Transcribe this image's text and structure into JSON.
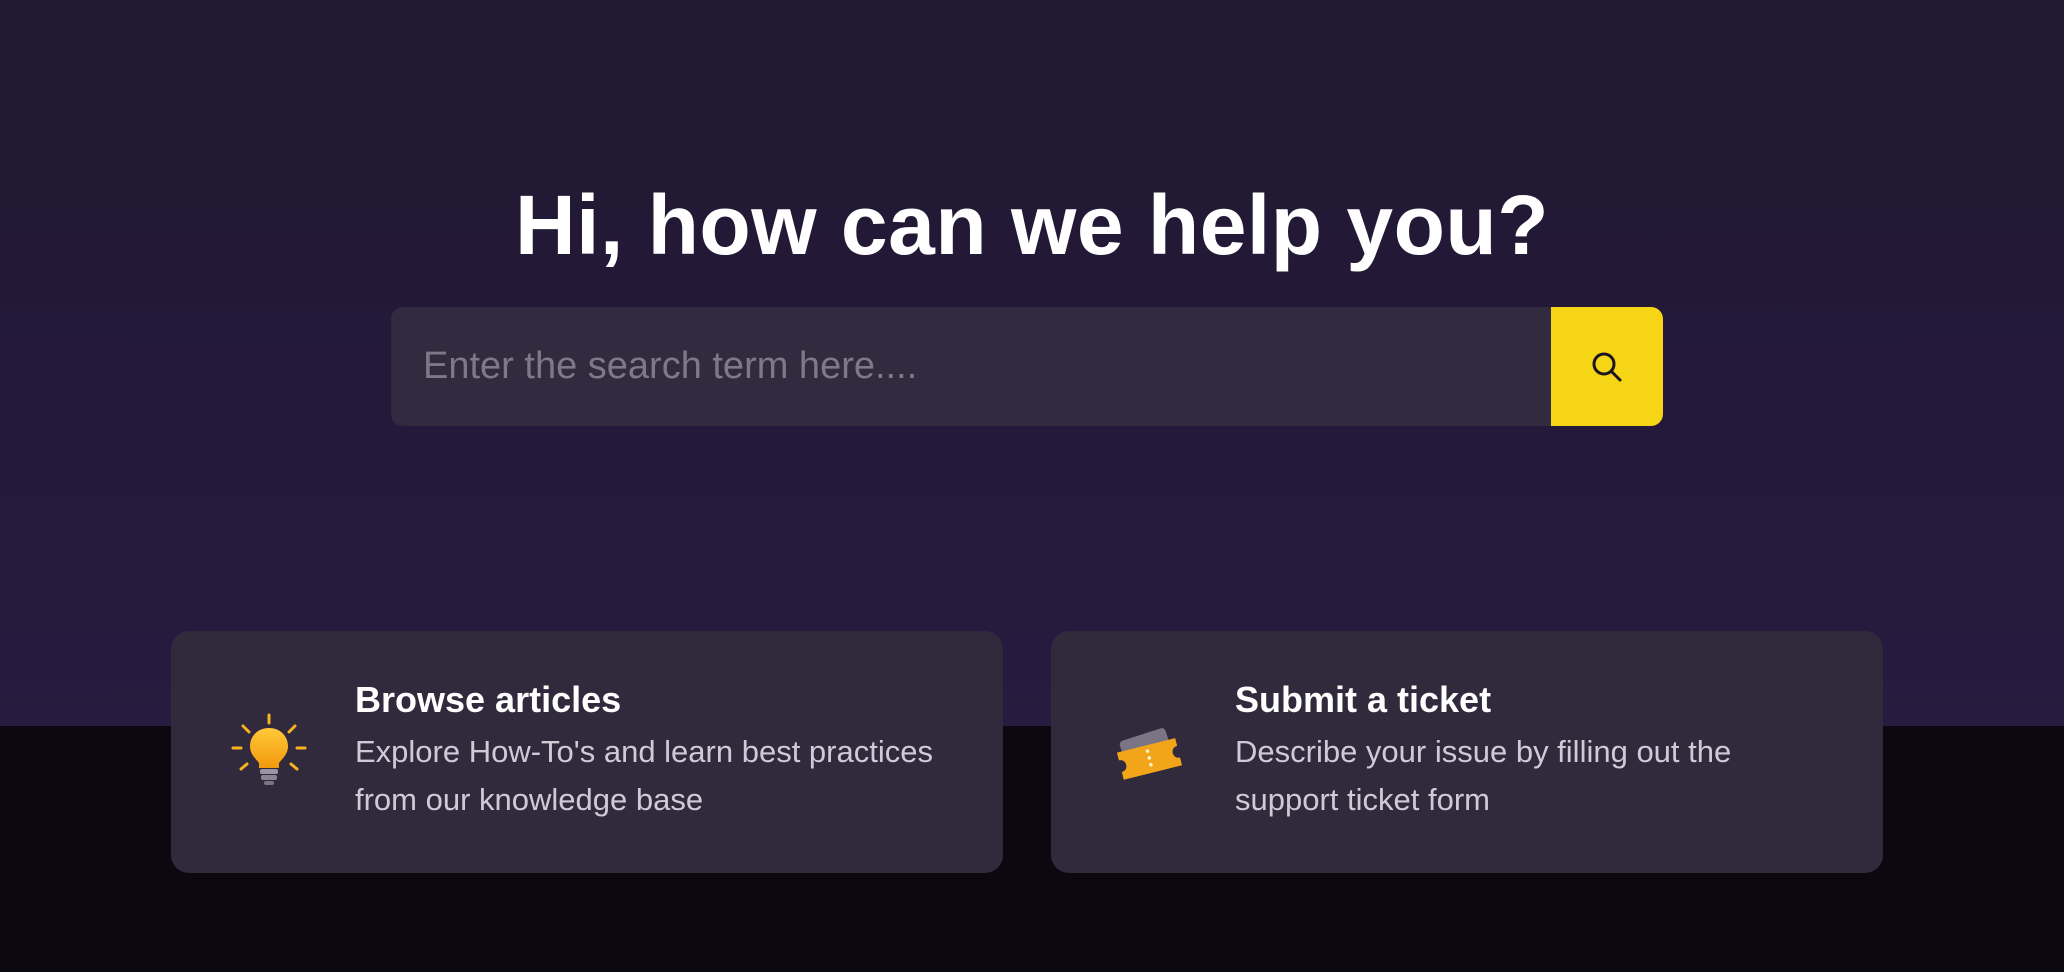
{
  "hero": {
    "title": "Hi, how can we help you?"
  },
  "search": {
    "placeholder": "Enter the search term here....",
    "value": "",
    "button_icon": "search-icon"
  },
  "cards": [
    {
      "icon": "lightbulb-icon",
      "title": "Browse articles",
      "description": "Explore How-To's and learn best practices from our knowledge base"
    },
    {
      "icon": "ticket-icon",
      "title": "Submit a ticket",
      "description": "Describe your issue by filling out the support ticket form"
    }
  ],
  "colors": {
    "hero_background": "#231a35",
    "bottom_background": "#0c0810",
    "accent": "#f6d517",
    "card_background": "#312a3d",
    "search_background": "#322a3e"
  }
}
